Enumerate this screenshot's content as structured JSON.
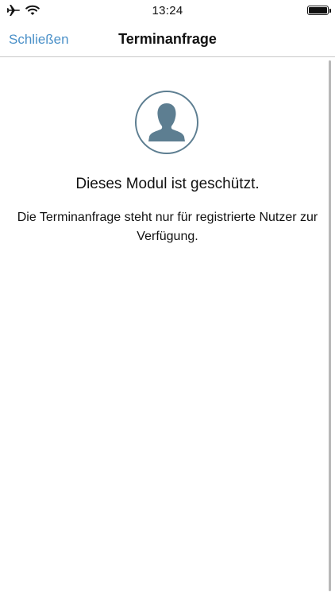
{
  "status_bar": {
    "time": "13:24",
    "icons": [
      "airplane-icon",
      "wifi-icon",
      "battery-icon"
    ]
  },
  "nav": {
    "close_label": "Schließen",
    "title": "Terminanfrage"
  },
  "locked_notice": {
    "icon": "user-silhouette-icon",
    "heading": "Dieses Modul ist geschützt.",
    "message": "Die Terminanfrage steht nur für registrierte Nutzer zur Verfügung."
  },
  "colors": {
    "accent": "#4a90c8",
    "avatar": "#5d7e91"
  }
}
